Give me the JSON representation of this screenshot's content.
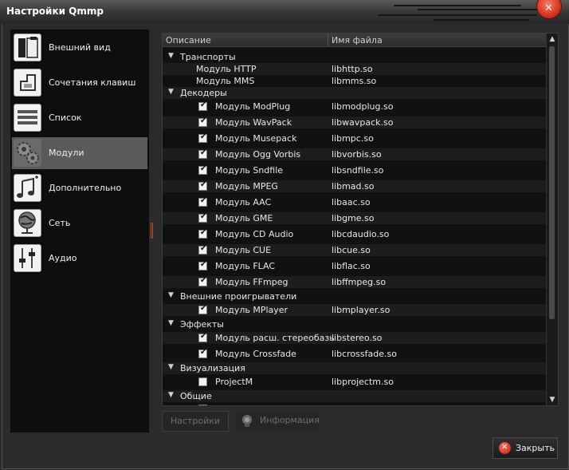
{
  "window": {
    "title": "Настройки Qmmp"
  },
  "sidebar": {
    "items": [
      {
        "label": "Внешний вид",
        "icon": "appearance-icon"
      },
      {
        "label": "Сочетания клавиш",
        "icon": "shortcuts-icon"
      },
      {
        "label": "Список",
        "icon": "playlist-icon"
      },
      {
        "label": "Модули",
        "icon": "plugins-gears-icon",
        "selected": true
      },
      {
        "label": "Дополнительно",
        "icon": "advanced-music-icon"
      },
      {
        "label": "Сеть",
        "icon": "network-globe-icon"
      },
      {
        "label": "Аудио",
        "icon": "audio-sliders-icon"
      }
    ]
  },
  "modules": {
    "columns": [
      "Описание",
      "Имя файла"
    ],
    "groups": {
      "transports": {
        "label": "Транспорты",
        "items": [
          {
            "label": "Модуль HTTP",
            "file": "libhttp.so"
          },
          {
            "label": "Модуль MMS",
            "file": "libmms.so"
          }
        ]
      },
      "decoders": {
        "label": "Декодеры",
        "items": [
          {
            "label": "Модуль ModPlug",
            "file": "libmodplug.so",
            "checked": true
          },
          {
            "label": "Модуль WavPack",
            "file": "libwavpack.so",
            "checked": true
          },
          {
            "label": "Модуль Musepack",
            "file": "libmpc.so",
            "checked": true
          },
          {
            "label": "Модуль Ogg Vorbis",
            "file": "libvorbis.so",
            "checked": true
          },
          {
            "label": "Модуль Sndfile",
            "file": "libsndfile.so",
            "checked": true
          },
          {
            "label": "Модуль MPEG",
            "file": "libmad.so",
            "checked": true
          },
          {
            "label": "Модуль AAC",
            "file": "libaac.so",
            "checked": true
          },
          {
            "label": "Модуль GME",
            "file": "libgme.so",
            "checked": true
          },
          {
            "label": "Модуль CD Audio",
            "file": "libcdaudio.so",
            "checked": true
          },
          {
            "label": "Модуль CUE",
            "file": "libcue.so",
            "checked": true
          },
          {
            "label": "Модуль FLAC",
            "file": "libflac.so",
            "checked": true
          },
          {
            "label": "Модуль FFmpeg",
            "file": "libffmpeg.so",
            "checked": true
          }
        ]
      },
      "external": {
        "label": "Внешние проигрыватели",
        "items": [
          {
            "label": "Модуль MPlayer",
            "file": "libmplayer.so",
            "checked": true
          }
        ]
      },
      "effects": {
        "label": "Эффекты",
        "items": [
          {
            "label": "Модуль расш. стереобазы",
            "file": "libstereo.so",
            "checked": true
          },
          {
            "label": "Модуль Crossfade",
            "file": "libcrossfade.so",
            "checked": true
          }
        ]
      },
      "visualization": {
        "label": "Визуализация",
        "items": [
          {
            "label": "ProjectM",
            "file": "libprojectm.so",
            "checked": false
          }
        ]
      },
      "general": {
        "label": "Общие",
        "items": []
      }
    }
  },
  "buttons": {
    "settings": "Настройки",
    "info": "Информация",
    "close": "Закрыть"
  },
  "colors": {
    "selection": "#5a5a5a",
    "close_accent": "#d3341f"
  }
}
